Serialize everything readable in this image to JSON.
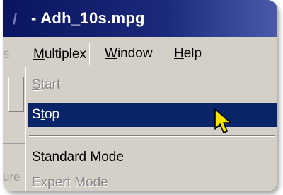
{
  "window": {
    "title_prefix": "- ",
    "title": "Adh_10s.mpg"
  },
  "menubar": {
    "items": [
      {
        "label": "Multiplex",
        "mnemonic": "M",
        "rest": "ultiplex"
      },
      {
        "label": "Window",
        "mnemonic": "W",
        "rest": "indow"
      },
      {
        "label": "Help",
        "mnemonic": "H",
        "rest": "elp"
      }
    ]
  },
  "dropdown": {
    "items": [
      {
        "label": "Start",
        "mnemonic": "S",
        "rest": "tart",
        "state": "disabled"
      },
      {
        "label": "Stop",
        "pre": "S",
        "mnemonic": "t",
        "rest": "op",
        "state": "selected"
      },
      {
        "label": "Standard Mode",
        "state": "enabled"
      },
      {
        "label": "Expert Mode",
        "state": "disabled"
      }
    ]
  },
  "colors": {
    "titlebar": "#0a246a",
    "selection": "#0a246a",
    "face": "#d4d0c8",
    "cursor": "#f5e400"
  },
  "icons": {
    "cursor": "arrow-cursor-icon"
  }
}
